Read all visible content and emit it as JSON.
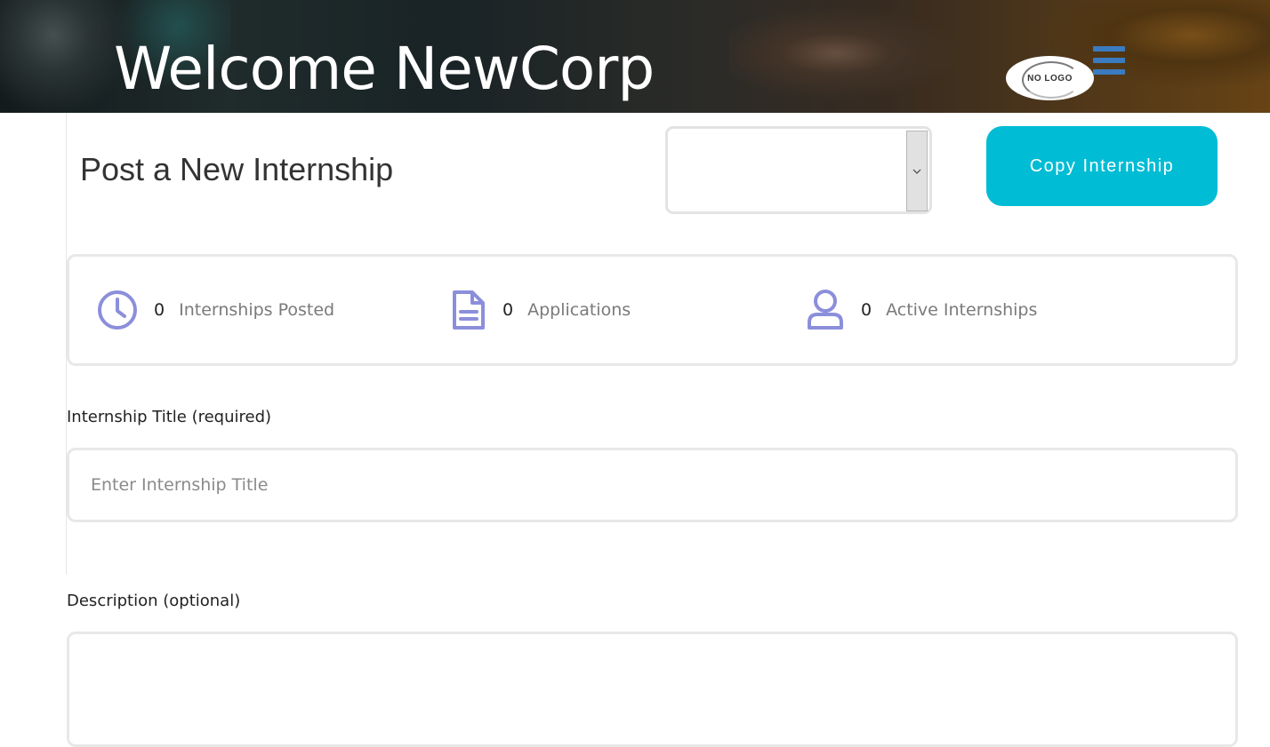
{
  "header": {
    "welcome_text": "Welcome NewCorp",
    "logo_text": "NO LOGO",
    "menu_icon": "hamburger-icon"
  },
  "page": {
    "title": "Post a New Internship",
    "select_value": "",
    "copy_button_label": "Copy Internship"
  },
  "stats": [
    {
      "icon": "clock-icon",
      "value": "0",
      "label": "Internships Posted"
    },
    {
      "icon": "document-icon",
      "value": "0",
      "label": "Applications"
    },
    {
      "icon": "user-icon",
      "value": "0",
      "label": "Active Internships"
    }
  ],
  "form": {
    "title_label": "Internship Title (required)",
    "title_placeholder": "Enter Internship Title",
    "title_value": "",
    "description_label": "Description (optional)",
    "description_value": ""
  },
  "colors": {
    "accent": "#00bcd4",
    "icon": "#8b8fdb",
    "menu": "#3b7bbf"
  }
}
